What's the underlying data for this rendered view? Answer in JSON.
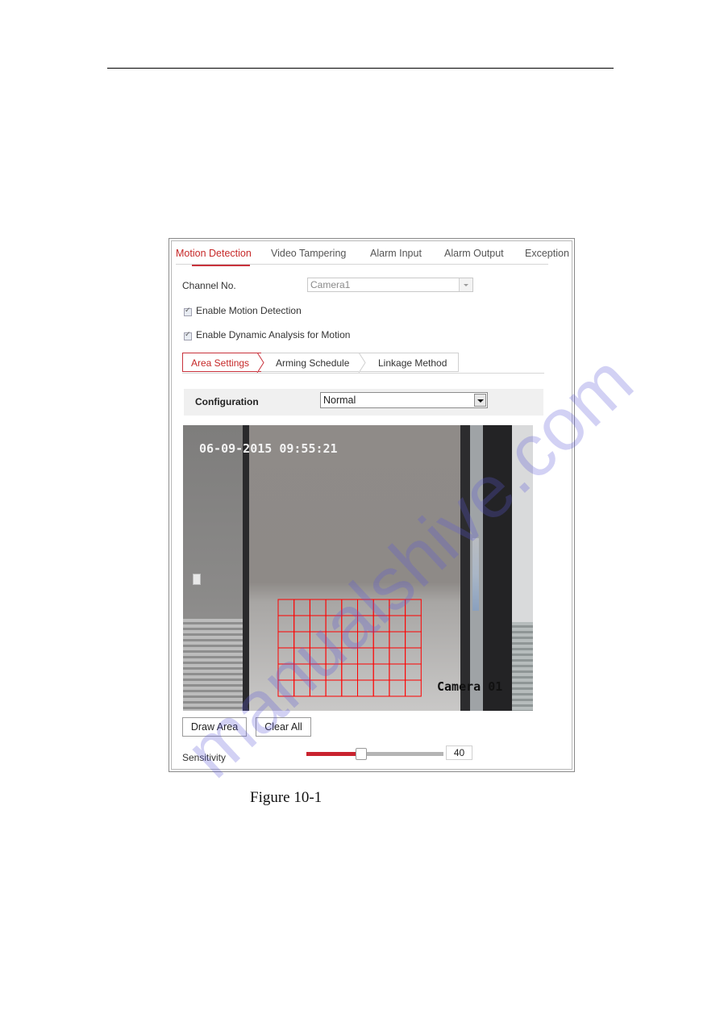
{
  "page": {
    "figure_caption": "Figure 10-1"
  },
  "main_tabs": [
    {
      "label": "Motion Detection",
      "active": true
    },
    {
      "label": "Video Tampering",
      "active": false
    },
    {
      "label": "Alarm Input",
      "active": false
    },
    {
      "label": "Alarm Output",
      "active": false
    },
    {
      "label": "Exception",
      "active": false
    }
  ],
  "channel": {
    "label": "Channel No.",
    "value": "Camera1",
    "disabled": true
  },
  "checkboxes": [
    {
      "label": "Enable Motion Detection",
      "checked": true
    },
    {
      "label": "Enable Dynamic Analysis for Motion",
      "checked": true
    }
  ],
  "sub_tabs": [
    {
      "label": "Area Settings",
      "active": true
    },
    {
      "label": "Arming Schedule",
      "active": false
    },
    {
      "label": "Linkage Method",
      "active": false
    }
  ],
  "configuration": {
    "label": "Configuration",
    "value": "Normal"
  },
  "video": {
    "timestamp": "06-09-2015 09:55:21",
    "camera_name": "Camera 01",
    "detection_grid": {
      "columns": 9,
      "rows": 6,
      "color": "#ff0000"
    }
  },
  "buttons": {
    "draw_area": "Draw Area",
    "clear_all": "Clear All"
  },
  "sensitivity": {
    "label": "Sensitivity",
    "value": "40",
    "fraction": 0.4,
    "fill_color": "#c9232f"
  },
  "watermark": "manualshive.com",
  "colors": {
    "accent": "#c62828"
  }
}
